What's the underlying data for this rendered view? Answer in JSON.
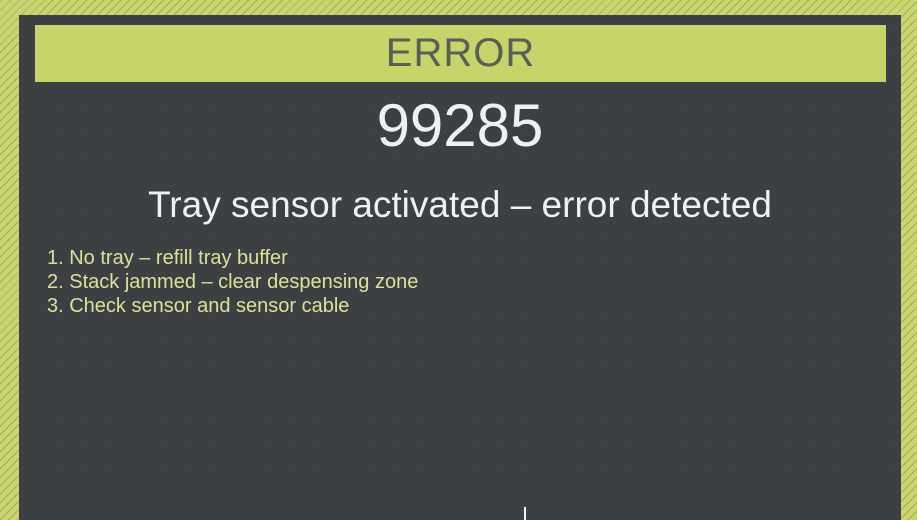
{
  "screen": {
    "header_label": "ERROR",
    "error_code": "99285",
    "error_message": "Tray sensor activated – error detected",
    "steps": [
      "1. No tray – refill tray buffer",
      "2. Stack jammed – clear despensing zone",
      "3. Check sensor and sensor cable"
    ]
  },
  "colors": {
    "frame_accent": "#cbd56f",
    "header_background": "#c7d46a",
    "screen_background": "#3c4042",
    "text_primary": "#eef0f2",
    "text_steps": "#dde09a"
  }
}
